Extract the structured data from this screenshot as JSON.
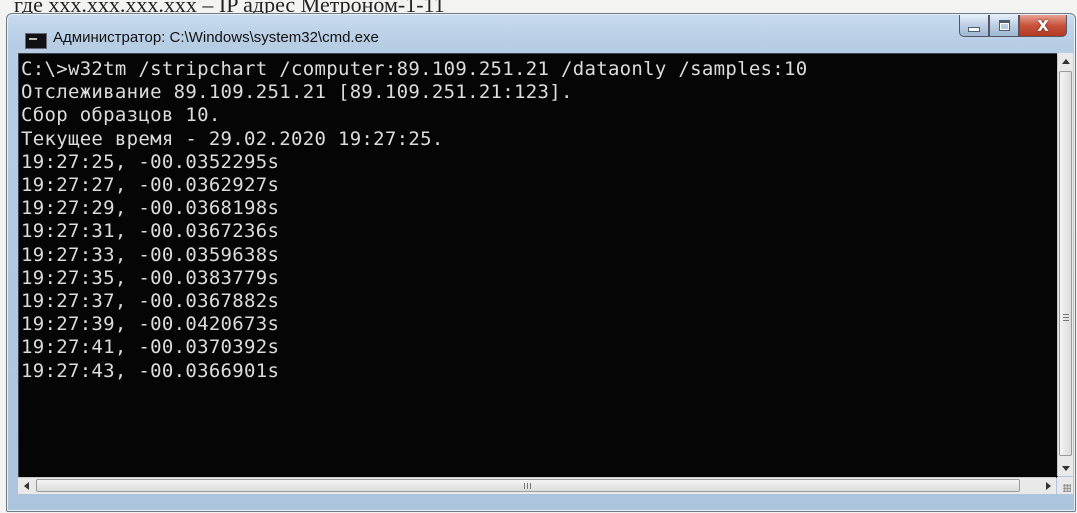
{
  "document_fragment": "где xxx.xxx.xxx.xxx – IP адрес Метроном-1-11",
  "window": {
    "title": "Администратор: C:\\Windows\\system32\\cmd.exe",
    "close_glyph": "X"
  },
  "console": {
    "lines": [
      "C:\\>w32tm /stripchart /computer:89.109.251.21 /dataonly /samples:10",
      "Отслеживание 89.109.251.21 [89.109.251.21:123].",
      "Сбор образцов 10.",
      "Текущее время - 29.02.2020 19:27:25.",
      "19:27:25, -00.0352295s",
      "19:27:27, -00.0362927s",
      "19:27:29, -00.0368198s",
      "19:27:31, -00.0367236s",
      "19:27:33, -00.0359638s",
      "19:27:35, -00.0383779s",
      "19:27:37, -00.0367882s",
      "19:27:39, -00.0420673s",
      "19:27:41, -00.0370392s",
      "19:27:43, -00.0366901s"
    ]
  },
  "icons": {
    "window": "console-icon",
    "minimize": "minimize-icon",
    "maximize": "maximize-icon",
    "close": "close-icon"
  },
  "colors": {
    "console_background": "#050505",
    "console_text": "#dcdcdc",
    "close_button": "#c8523c"
  }
}
